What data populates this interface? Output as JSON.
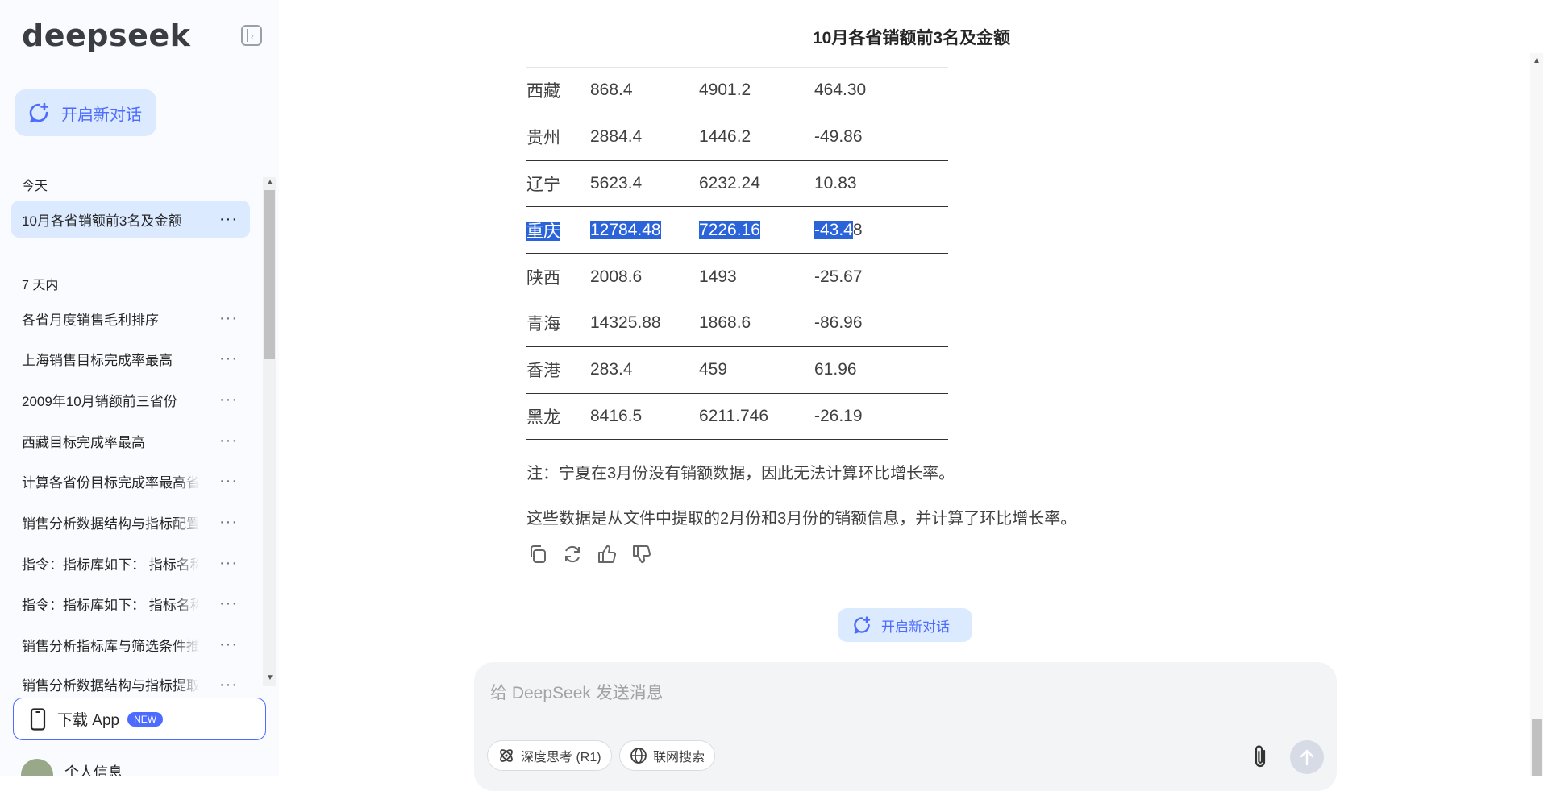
{
  "sidebar": {
    "logo": "deepseek",
    "new_chat_label": "开启新对话",
    "sections": {
      "today": "今天",
      "week": "7 天内"
    },
    "today_items": [
      {
        "label": "10月各省销额前3名及金额"
      }
    ],
    "week_items": [
      {
        "label": "各省月度销售毛利排序"
      },
      {
        "label": "上海销售目标完成率最高"
      },
      {
        "label": "2009年10月销额前三省份"
      },
      {
        "label": "西藏目标完成率最高"
      },
      {
        "label": "计算各省份目标完成率最高省份"
      },
      {
        "label": "销售分析数据结构与指标配置"
      },
      {
        "label": "指令：指标库如下： 指标名称"
      },
      {
        "label": "指令：指标库如下： 指标名称"
      },
      {
        "label": "销售分析指标库与筛选条件推荐"
      },
      {
        "label": "销售分析数据结构与指标提取"
      }
    ],
    "more_glyph": "···",
    "download_app": "下载 App",
    "new_badge": "NEW",
    "user_name": "个人信息"
  },
  "main": {
    "title": "10月各省销额前3名及金额",
    "table_rows": [
      [
        "西藏",
        "868.4",
        "4901.2",
        "464.30"
      ],
      [
        "贵州",
        "2884.4",
        "1446.2",
        "-49.86"
      ],
      [
        "辽宁",
        "5623.4",
        "6232.24",
        "10.83"
      ],
      [
        "重庆",
        "12784.48",
        "7226.16",
        "-43.48"
      ],
      [
        "陕西",
        "2008.6",
        "1493",
        "-25.67"
      ],
      [
        "青海",
        "14325.88",
        "1868.6",
        "-86.96"
      ],
      [
        "香港",
        "283.4",
        "459",
        "61.96"
      ],
      [
        "黑龙",
        "8416.5",
        "6211.746",
        "-26.19"
      ]
    ],
    "highlighted_row": {
      "c0": "重庆",
      "c1": "12784.48",
      "c2": "7226.16",
      "c3_selected": "-43.4",
      "c3_rest": "8"
    },
    "note1": "注：宁夏在3月份没有销额数据，因此无法计算环比增长率。",
    "note2": "这些数据是从文件中提取的2月份和3月份的销额信息，并计算了环比增长率。",
    "new_chat_label": "开启新对话",
    "input_placeholder": "给 DeepSeek 发送消息",
    "deep_think_label": "深度思考 (R1)",
    "web_search_label": "联网搜索"
  },
  "colors": {
    "accent": "#4d6bfe",
    "selection": "#2b63d9",
    "active_bg": "#dbeafe"
  }
}
